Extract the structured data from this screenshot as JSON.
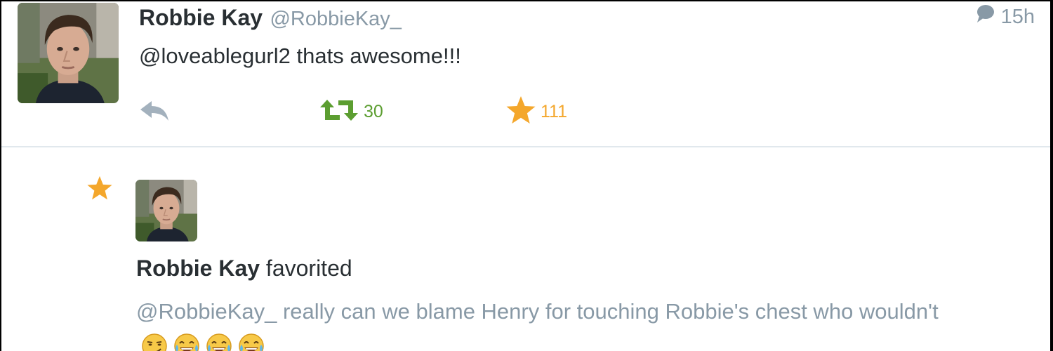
{
  "tweet": {
    "display_name": "Robbie Kay",
    "handle": "@RobbieKay_",
    "time": "15h",
    "text": "@loveablegurl2 thats awesome!!!",
    "retweet_count": "30",
    "favorite_count": "111",
    "icons": {
      "conversation": "speech-bubble-icon",
      "reply": "reply-arrow-icon",
      "retweet": "retweet-icon",
      "favorite": "star-icon"
    }
  },
  "activity": {
    "actor_name": "Robbie Kay",
    "action_text": "favorited",
    "quoted_text": "@RobbieKay_ really can we blame Henry for touching Robbie's chest who wouldn't",
    "emojis": [
      "smirking-face-emoji",
      "tears-of-joy-emoji",
      "tears-of-joy-emoji",
      "tears-of-joy-emoji"
    ]
  },
  "colors": {
    "text_primary": "#292f33",
    "text_secondary": "#8899a6",
    "retweet_green": "#5c9e31",
    "favorite_gold": "#f4a72c",
    "divider": "#e1e8ed"
  }
}
